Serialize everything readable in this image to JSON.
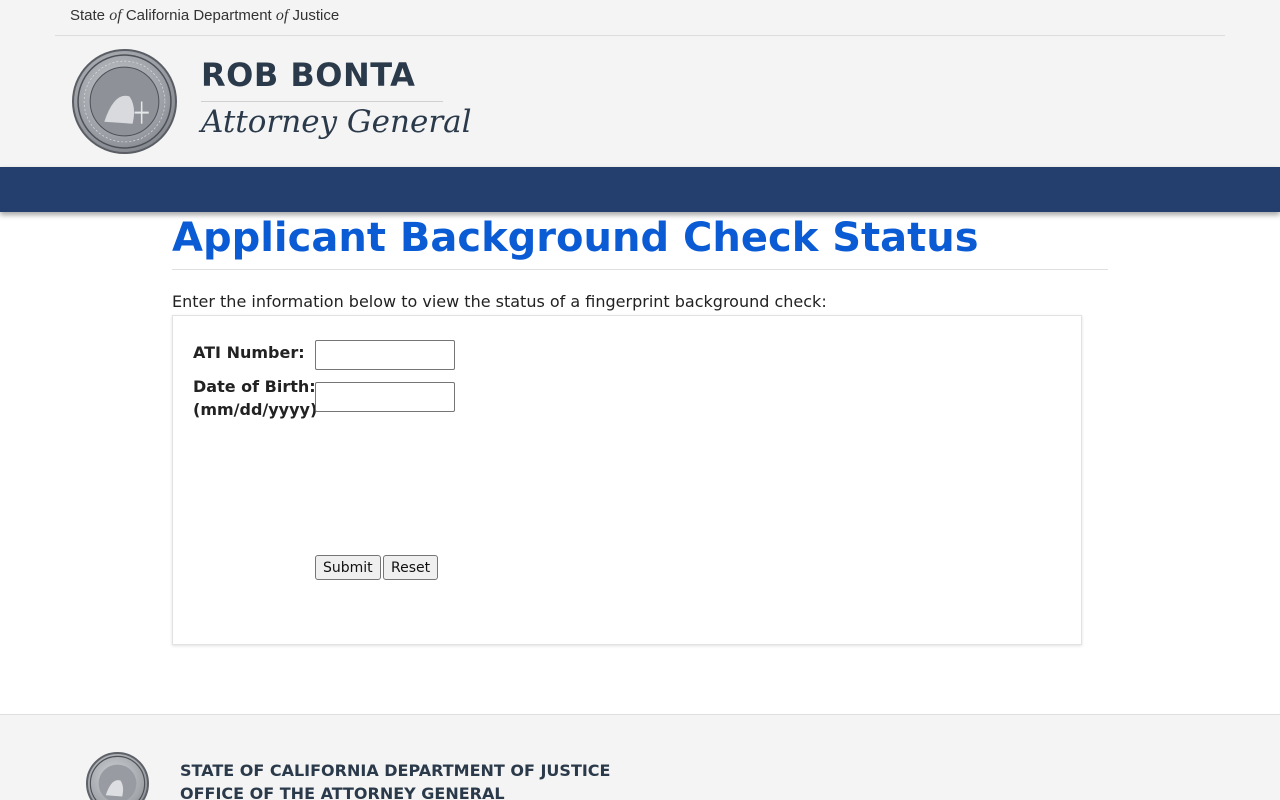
{
  "header": {
    "topline_parts": [
      "State ",
      "of",
      " California Department ",
      "of",
      " Justice"
    ],
    "ag_name": "ROB BONTA",
    "ag_title": "Attorney General",
    "seal_icon": "california-doj-seal-icon"
  },
  "main": {
    "title": "Applicant Background Check Status",
    "intro": "Enter the information below to view the status of a fingerprint background check:"
  },
  "form": {
    "ati_label": "ATI Number:",
    "ati_value": "",
    "dob_label_line1": "Date of Birth:",
    "dob_label_line2": "(mm/dd/yyyy)",
    "dob_value": "",
    "submit_label": "Submit",
    "reset_label": "Reset"
  },
  "footer": {
    "line1": "STATE OF CALIFORNIA DEPARTMENT OF JUSTICE",
    "line2": "OFFICE OF THE ATTORNEY GENERAL"
  },
  "colors": {
    "navbar": "#243f6e",
    "title_blue": "#0b5bd4",
    "header_bg": "#f4f4f4"
  }
}
